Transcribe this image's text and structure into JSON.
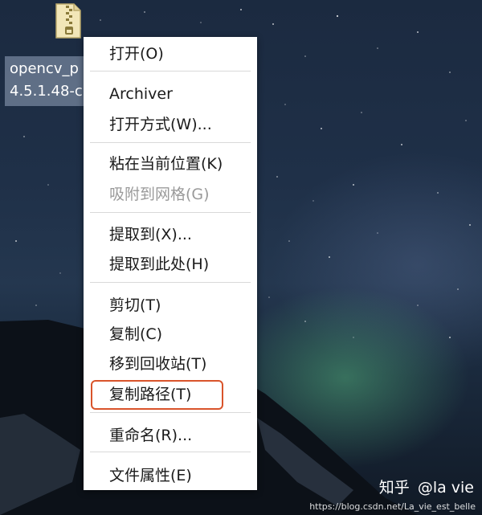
{
  "desktop": {
    "file": {
      "icon": "archive-zip-icon",
      "label_line1": "opencv_p",
      "label_line2": "4.5.1.48-c"
    }
  },
  "context_menu": {
    "groups": [
      {
        "items": [
          {
            "label": "打开(O)",
            "enabled": true
          }
        ]
      },
      {
        "items": [
          {
            "label": "Archiver",
            "enabled": true
          },
          {
            "label": "打开方式(W)...",
            "enabled": true
          }
        ]
      },
      {
        "items": [
          {
            "label": "粘在当前位置(K)",
            "enabled": true
          },
          {
            "label": "吸附到网格(G)",
            "enabled": false
          }
        ]
      },
      {
        "items": [
          {
            "label": "提取到(X)...",
            "enabled": true
          },
          {
            "label": "提取到此处(H)",
            "enabled": true
          }
        ]
      },
      {
        "items": [
          {
            "label": "剪切(T)",
            "enabled": true
          },
          {
            "label": "复制(C)",
            "enabled": true
          },
          {
            "label": "移到回收站(T)",
            "enabled": true
          },
          {
            "label": "复制路径(T)",
            "enabled": true,
            "highlighted": true
          }
        ]
      },
      {
        "items": [
          {
            "label": "重命名(R)...",
            "enabled": true
          }
        ]
      },
      {
        "items": [
          {
            "label": "文件属性(E)",
            "enabled": true
          }
        ]
      }
    ],
    "highlight_color": "#d9542b"
  },
  "watermark": {
    "zhihu": "知乎",
    "author": "@la vie",
    "url": "https://blog.csdn.net/La_vie_est_belle"
  }
}
